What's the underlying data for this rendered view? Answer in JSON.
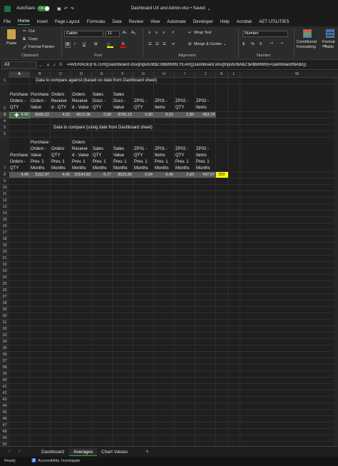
{
  "titlebar": {
    "autosave_label": "AutoSave",
    "autosave_state": "On",
    "doc_title": "Dashboard UX and Admin.xlsx • Saved"
  },
  "menu": [
    "File",
    "Home",
    "Insert",
    "Page Layout",
    "Formulas",
    "Data",
    "Review",
    "View",
    "Automate",
    "Developer",
    "Help",
    "Acrobat",
    "AET UTILITIES"
  ],
  "ribbon": {
    "paste": "Paste",
    "cut": "Cut",
    "copy": "Copy",
    "format_painter": "Format Painter",
    "clipboard": "Clipboard",
    "font_name": "Calibri",
    "font_size": "11",
    "bold": "B",
    "italic": "I",
    "underline": "U",
    "font": "Font",
    "wrap_text": "Wrap Text",
    "merge_center": "Merge & Center",
    "alignment": "Alignment",
    "number_format": "Number",
    "number": "Number",
    "conditional": "Conditional",
    "conditional2": "Formatting",
    "format_as": "Format as",
    "format_as2": "Table"
  },
  "formula_bar": {
    "name_box": "A3",
    "fx": "fx",
    "formula": "=AVERAGE(FILTER([Dashboard.xlsx]Inputs!B$2:B$99999,YEAR([Dashboard.xlsx]Inputs!$A$2:$A$99999)=Dashboard!$A$3))"
  },
  "columns": [
    "A",
    "B",
    "C",
    "D",
    "E",
    "F",
    "G",
    "H",
    "I",
    "J",
    "K",
    "L",
    "M"
  ],
  "rows": [
    "1",
    "2",
    "3",
    "4",
    "5",
    "6",
    "7",
    "8",
    "9",
    "10",
    "11",
    "12",
    "13",
    "14",
    "15",
    "16",
    "17",
    "18",
    "19",
    "20",
    "21",
    "22",
    "23",
    "24",
    "25",
    "26",
    "27",
    "28",
    "29",
    "30",
    "31",
    "32",
    "33",
    "34",
    "35",
    "36",
    "37",
    "38",
    "39",
    "40",
    "41",
    "42",
    "43",
    "44",
    "45",
    "46",
    "47",
    "48",
    "49",
    "50",
    "51",
    "52",
    "53",
    "54",
    "55",
    "56"
  ],
  "table1": {
    "title": "Data to compare against (based on date from Dashboard sheet)",
    "headers": [
      [
        "Purchase",
        "Orders -",
        "QTY"
      ],
      [
        "Purchase",
        "Orders -",
        "Value"
      ],
      [
        "Orders",
        "Receive",
        "d - QTY"
      ],
      [
        "Orders",
        "Receive",
        "d - Value"
      ],
      [
        "Sales",
        "Docs -",
        "QTY"
      ],
      [
        "Sales",
        "Docs -",
        "Value"
      ],
      [
        "",
        "ZP01 -",
        "QTY"
      ],
      [
        "",
        "ZP01 -",
        "Items"
      ],
      [
        "",
        "ZP02 -",
        "QTY"
      ],
      [
        "",
        "ZP02 -",
        "Items"
      ]
    ],
    "values": [
      "4,40",
      "5069,22",
      "4,02",
      "9612,36",
      "0,68",
      "8755,12",
      "0,90",
      "6,01",
      "2,80",
      "453,74"
    ]
  },
  "table2": {
    "title": "Data to compare (using date from Dashboard sheet)",
    "headers": [
      [
        "",
        "",
        "Purchase",
        "Orders -",
        "QTY"
      ],
      [
        "Purchase",
        "Orders -",
        "Value",
        "Prev. 1",
        "Months"
      ],
      [
        "",
        "Orders",
        "QTY",
        "Prev. 1",
        "Months"
      ],
      [
        "Orders",
        "Receive",
        "d - Value",
        "Prev. 1",
        "Months"
      ],
      [
        "",
        "Sales",
        "QTY",
        "Prev. 1",
        "Months"
      ],
      [
        "",
        "Sales",
        "Value",
        "Prev. 1",
        "Months"
      ],
      [
        "",
        "ZP01 -",
        "QTY",
        "Prev. 1",
        "Months"
      ],
      [
        "",
        "ZP01 -",
        "Items",
        "Prev. 1",
        "Months"
      ],
      [
        "",
        "ZP02 -",
        "QTY",
        "Prev. 1",
        "Months"
      ],
      [
        "",
        "ZP02 -",
        "Items",
        "Prev. 1",
        "Months"
      ]
    ],
    "values": [
      "4,45",
      "5112,97",
      "4,42",
      "10104,83",
      "0,77",
      "8522,80",
      "0,94",
      "6,46",
      "2,93",
      "437,97"
    ],
    "k_value": "259"
  },
  "sheet_tabs": [
    "Dashboard",
    "Averages",
    "Chart Values"
  ],
  "active_tab": "Averages",
  "status": {
    "ready": "Ready",
    "accessibility": "Accessibility: Investigate"
  },
  "colors": {
    "accent": "#3ea047",
    "highlight_cell": "#ffff00",
    "selected_row": "#595959"
  }
}
